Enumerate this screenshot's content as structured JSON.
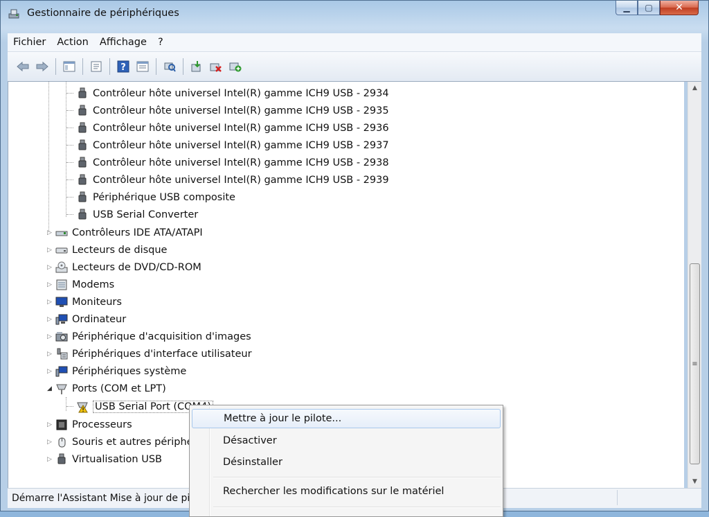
{
  "window": {
    "title": "Gestionnaire de périphériques"
  },
  "menu": [
    "Fichier",
    "Action",
    "Affichage",
    "?"
  ],
  "tree": {
    "usb_children": [
      "Contrôleur hôte universel Intel(R) gamme ICH9 USB - 2934",
      "Contrôleur hôte universel Intel(R) gamme ICH9 USB - 2935",
      "Contrôleur hôte universel Intel(R) gamme ICH9 USB - 2936",
      "Contrôleur hôte universel Intel(R) gamme ICH9 USB - 2937",
      "Contrôleur hôte universel Intel(R) gamme ICH9 USB - 2938",
      "Contrôleur hôte universel Intel(R) gamme ICH9 USB - 2939",
      "Périphérique USB composite",
      "USB Serial Converter"
    ],
    "categories_a": [
      "Contrôleurs IDE ATA/ATAPI",
      "Lecteurs de disque",
      "Lecteurs de DVD/CD-ROM",
      "Modems",
      "Moniteurs",
      "Ordinateur",
      "Périphérique d'acquisition d'images",
      "Périphériques d'interface utilisateur",
      "Périphériques système"
    ],
    "ports": "Ports (COM et LPT)",
    "ports_child": "USB Serial Port (COM4)",
    "categories_b": [
      "Processeurs",
      "Souris et autres périphériques de pointage",
      "Virtualisation USB"
    ]
  },
  "status": {
    "text": "Démarre l'Assistant Mise à jour de pilote logiciel pour le périphérique sélectionné."
  },
  "context_menu": {
    "update": "Mettre à jour le pilote...",
    "disable": "Désactiver",
    "uninstall": "Désinstaller",
    "scan": "Rechercher les modifications sur le matériel"
  }
}
